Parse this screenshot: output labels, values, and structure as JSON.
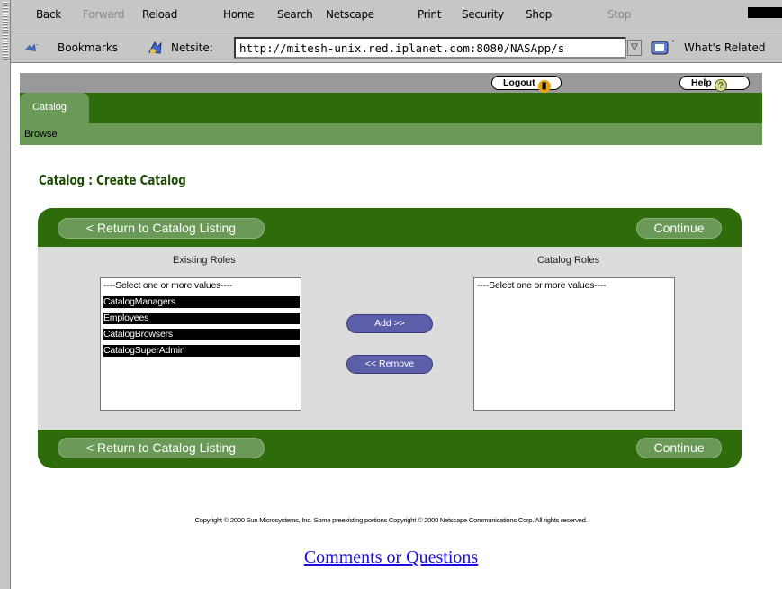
{
  "browser": {
    "nav": {
      "back": "Back",
      "forward": "Forward",
      "reload": "Reload",
      "home": "Home",
      "search": "Search",
      "netscape": "Netscape",
      "print": "Print",
      "security": "Security",
      "shop": "Shop",
      "stop": "Stop"
    },
    "location": {
      "bookmarks": "Bookmarks",
      "netsite": "Netsite:",
      "url": "http://mitesh-unix.red.iplanet.com:8080/NASApp/s",
      "whats_related": "What's Related"
    }
  },
  "app": {
    "logout": "Logout",
    "help": "Help",
    "tab": "Catalog",
    "subnav": "Browse",
    "page_title": "Catalog : Create Catalog"
  },
  "panel": {
    "return_label": "< Return to Catalog Listing",
    "continue_label": "Continue",
    "existing_roles_label": "Existing Roles",
    "catalog_roles_label": "Catalog Roles",
    "existing_options": [
      {
        "label": "----Select one or more values----",
        "selected": false
      },
      {
        "label": "CatalogManagers",
        "selected": true
      },
      {
        "label": "Employees",
        "selected": true
      },
      {
        "label": "CatalogBrowsers",
        "selected": true
      },
      {
        "label": "CatalogSuperAdmin",
        "selected": true
      }
    ],
    "catalog_options": [
      {
        "label": "----Select one or more values----",
        "selected": false
      }
    ],
    "add_label": "Add >>",
    "remove_label": "<< Remove"
  },
  "footer": {
    "copyright": "Copyright © 2000 Sun Microsystems, Inc. Some preexisting portions Copyright © 2000 Netscape Communications Corp. All rights reserved.",
    "comments": "Comments or Questions"
  },
  "colors": {
    "dark_green": "#2d6b0b",
    "light_green": "#6b9a58",
    "panel_gray": "#dcdcdc",
    "button_blue": "#5c5ea9",
    "link_blue": "#1a0de0"
  }
}
